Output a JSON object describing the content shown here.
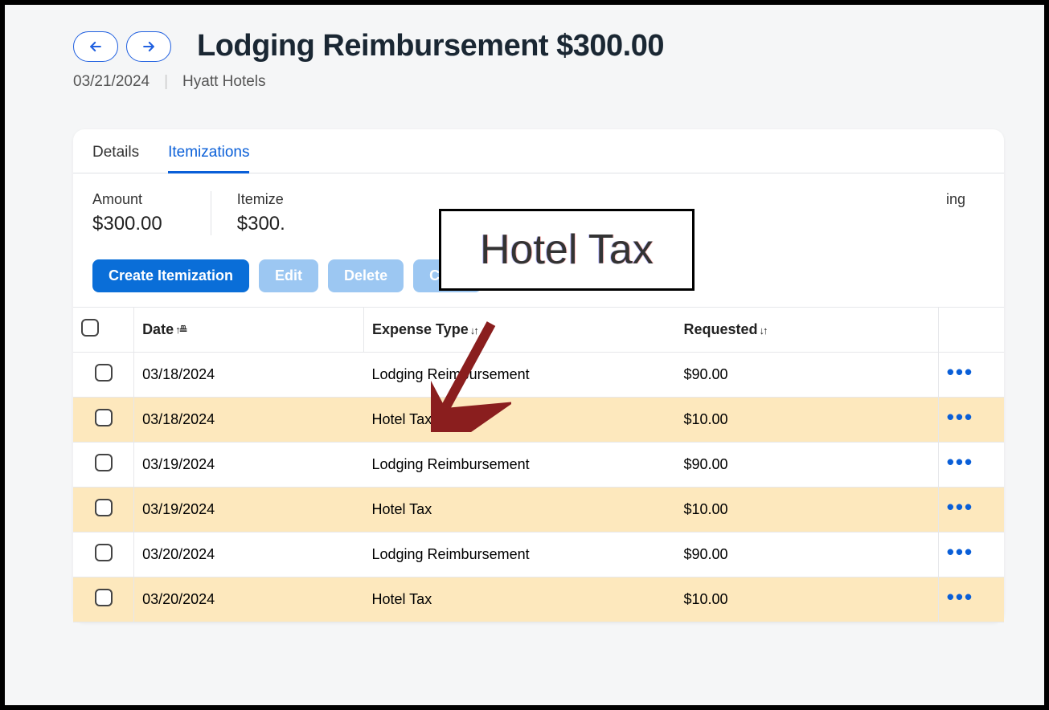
{
  "header": {
    "title": "Lodging Reimbursement $300.00",
    "date": "03/21/2024",
    "vendor": "Hyatt Hotels"
  },
  "tabs": {
    "details": "Details",
    "itemizations": "Itemizations"
  },
  "summary": {
    "amount_label": "Amount",
    "amount_value": "$300.00",
    "itemized_label_partial": "Itemize",
    "itemized_value_partial": "$300.",
    "remaining_partial": "ing"
  },
  "actions": {
    "create": "Create Itemization",
    "edit": "Edit",
    "delete": "Delete",
    "copy": "Copy"
  },
  "table": {
    "headers": {
      "date": "Date",
      "expense_type": "Expense Type",
      "requested": "Requested"
    },
    "rows": [
      {
        "date": "03/18/2024",
        "type": "Lodging Reimbursement",
        "requested": "$90.00",
        "highlight": false
      },
      {
        "date": "03/18/2024",
        "type": "Hotel Tax",
        "requested": "$10.00",
        "highlight": true
      },
      {
        "date": "03/19/2024",
        "type": "Lodging Reimbursement",
        "requested": "$90.00",
        "highlight": false
      },
      {
        "date": "03/19/2024",
        "type": "Hotel Tax",
        "requested": "$10.00",
        "highlight": true
      },
      {
        "date": "03/20/2024",
        "type": "Lodging Reimbursement",
        "requested": "$90.00",
        "highlight": false
      },
      {
        "date": "03/20/2024",
        "type": "Hotel Tax",
        "requested": "$10.00",
        "highlight": true
      }
    ]
  },
  "annotation": {
    "callout_text": "Hotel Tax"
  }
}
